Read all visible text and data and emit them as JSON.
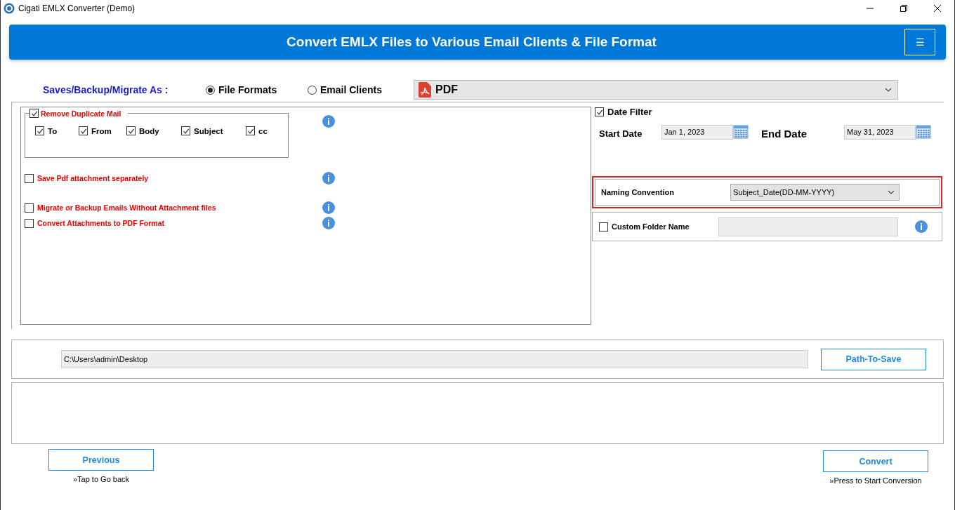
{
  "window": {
    "title": "Cigati EMLX Converter (Demo)"
  },
  "header": {
    "title": "Convert EMLX Files to Various Email Clients & File Format",
    "menu_button": "☰"
  },
  "save_as": {
    "label": "Saves/Backup/Migrate As :",
    "format": "PDF",
    "options": [
      {
        "label": "File Formats",
        "selected": true
      },
      {
        "label": "Email Clients",
        "selected": false
      }
    ]
  },
  "duplicate_group": {
    "label": "Remove Duplicate Mail",
    "checked": true,
    "fields": [
      {
        "label": "To",
        "checked": true
      },
      {
        "label": "From",
        "checked": true
      },
      {
        "label": "Body",
        "checked": true
      },
      {
        "label": "Subject",
        "checked": true
      },
      {
        "label": "cc",
        "checked": true
      }
    ]
  },
  "options": [
    {
      "label": "Save Pdf attachment separately",
      "checked": false
    },
    {
      "label": "Migrate or Backup Emails Without Attachment files",
      "checked": false
    },
    {
      "label": "Convert Attachments to PDF Format",
      "checked": false
    }
  ],
  "date_filter": {
    "label": "Date Filter",
    "checked": true,
    "start_label": "Start Date",
    "start": "Jan 1, 2023",
    "end_label": "End Date",
    "end": "May 31, 2023"
  },
  "naming": {
    "label": "Naming Convention",
    "value": "Subject_Date(DD-MM-YYYY)"
  },
  "custom_folder": {
    "label": "Custom Folder Name",
    "checked": false
  },
  "path": {
    "value": "C:\\Users\\admin\\Desktop",
    "button": "Path-To-Save"
  },
  "previous": {
    "button": "Previous",
    "hint": "»Tap to Go back"
  },
  "convert": {
    "button": "Convert",
    "hint": "»Press to Start Conversion"
  }
}
